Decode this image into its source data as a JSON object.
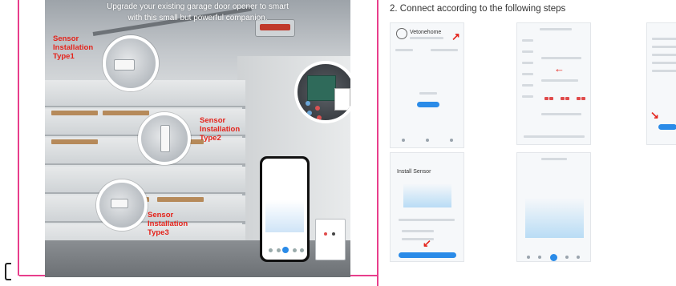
{
  "header": {
    "line1": "Upgrade your existing garage door opener to smart",
    "line2": "with this small but powerful companion."
  },
  "sensors": [
    {
      "line1": "Sensor",
      "line2": "Installation",
      "line3": "Type1"
    },
    {
      "line1": "Sensor",
      "line2": "Installation",
      "line3": "Type2"
    },
    {
      "line1": "Sensor",
      "line2": "Installation",
      "line3": "Type3"
    }
  ],
  "steps": {
    "title": "2. Connect according to the following steps",
    "app_brand": "Vetonehome",
    "install_title": "Install Sensor"
  },
  "colors": {
    "frame": "#e83e8c",
    "accent_red": "#e4231b",
    "app_blue": "#2a8be8"
  }
}
